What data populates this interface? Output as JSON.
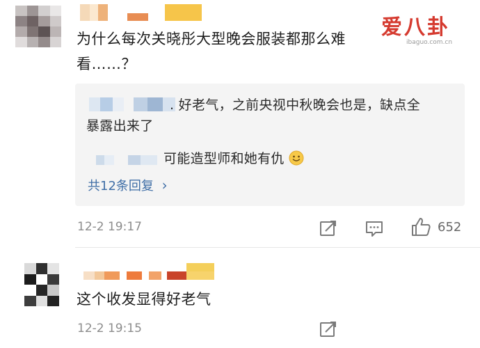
{
  "watermark": {
    "brand": "爱八卦",
    "url": "ibaguo.com.cn",
    "color": "#d53a2f"
  },
  "comments": [
    {
      "text_line1": "为什么每次关晓彤大型晚会服装都那么难",
      "text_line2": "看……？",
      "replies": [
        {
          "text_line1": ". 好老气，之前央视中秋晚会也是，缺点全",
          "text_line2": "暴露出来了"
        },
        {
          "text_line1": "可能造型师和她有仇",
          "emoji": "smile-emoji"
        }
      ],
      "more_replies_label": "共12条回复",
      "more_replies_arrow": "›",
      "time": "12-2 19:17",
      "like_count": "652"
    },
    {
      "text": "这个收发显得好老气",
      "time": "12-2 19:15"
    }
  ],
  "icons": {
    "share": "share-icon",
    "comment": "comment-icon",
    "like": "thumbs-up-icon",
    "more_arrow": "chevron-right-icon"
  },
  "colors": {
    "link": "#3f6ea6",
    "meta": "#8c8c8c",
    "reply_bg": "#f4f4f4",
    "brand_red": "#d53a2f"
  }
}
